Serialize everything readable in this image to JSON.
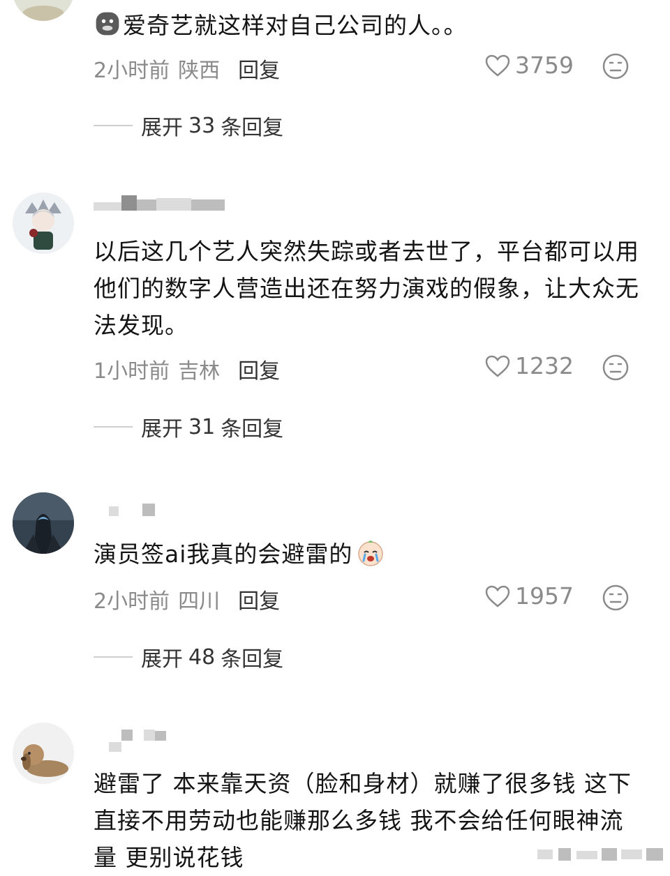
{
  "comments": [
    {
      "text": "爱奇艺就这样对自己公司的人。。",
      "time": "2小时前",
      "region": "陕西",
      "reply_label": "回复",
      "likes": "3759",
      "expand": {
        "prefix": "展开",
        "count": "33",
        "suffix": "条回复"
      }
    },
    {
      "text": "以后这几个艺人突然失踪或者去世了，平台都可以用他们的数字人营造出还在努力演戏的假象，让大众无法发现。",
      "time": "1小时前",
      "region": "吉林",
      "reply_label": "回复",
      "likes": "1232",
      "expand": {
        "prefix": "展开",
        "count": "31",
        "suffix": "条回复"
      }
    },
    {
      "text": "演员签ai我真的会避雷的",
      "time": "2小时前",
      "region": "四川",
      "reply_label": "回复",
      "likes": "1957",
      "expand": {
        "prefix": "展开",
        "count": "48",
        "suffix": "条回复"
      }
    },
    {
      "text": "避雷了 本来靠天资（脸和身材）就赚了很多钱 这下直接不用劳动也能赚那么多钱 我不会给任何眼神流量 更别说花钱"
    }
  ],
  "icons": {
    "like": "heart-outline-icon",
    "dislike": "neutral-face-icon",
    "emoji_1": "mask-emoji-icon",
    "emoji_3": "crying-emoji-icon"
  },
  "colors": {
    "meta": "#8a8a8a",
    "text": "#141414",
    "divider": "#cfcfcf"
  }
}
